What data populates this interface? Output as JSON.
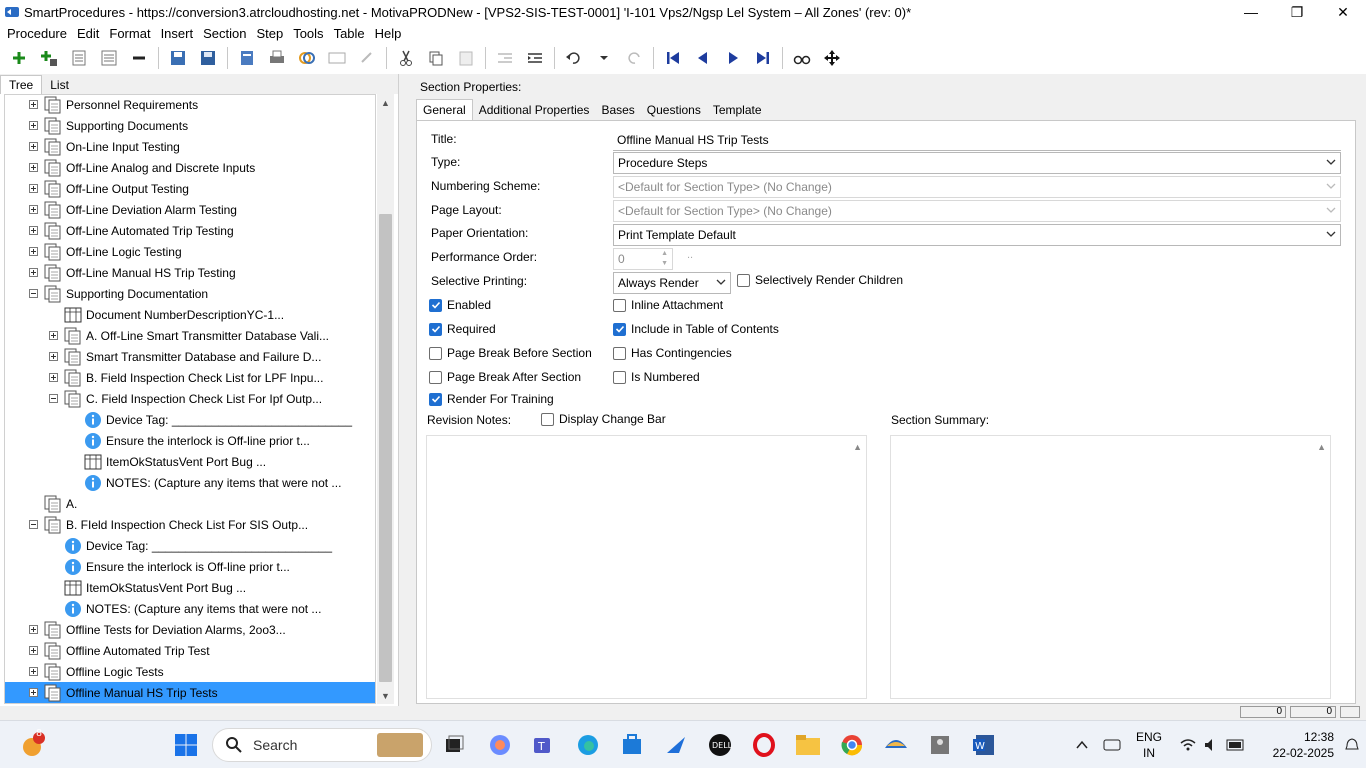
{
  "window": {
    "title": "SmartProcedures - https://conversion3.atrcloudhosting.net - MotivaPRODNew - [VPS2-SIS-TEST-0001] 'I-101 Vps2/Ngsp Lel System – All Zones' (rev: 0)*",
    "minimize": "—",
    "restore": "❐",
    "close": "✕"
  },
  "menu": [
    "Procedure",
    "Edit",
    "Format",
    "Insert",
    "Section",
    "Step",
    "Tools",
    "Table",
    "Help"
  ],
  "left_tabs": [
    "Tree",
    "List"
  ],
  "tree": [
    {
      "label": "Personnel Requirements",
      "expander": "plus",
      "icon": "section"
    },
    {
      "label": "Supporting Documents",
      "expander": "plus",
      "icon": "section"
    },
    {
      "label": "On-Line Input Testing",
      "expander": "plus",
      "icon": "section"
    },
    {
      "label": "Off-Line Analog and Discrete Inputs",
      "expander": "plus",
      "icon": "section"
    },
    {
      "label": "Off-Line Output Testing",
      "expander": "plus",
      "icon": "section"
    },
    {
      "label": "Off-Line Deviation Alarm Testing",
      "expander": "plus",
      "icon": "section"
    },
    {
      "label": "Off-Line Automated Trip Testing",
      "expander": "plus",
      "icon": "section"
    },
    {
      "label": "Off-Line Logic Testing",
      "expander": "plus",
      "icon": "section"
    },
    {
      "label": "Off-Line Manual HS Trip Testing",
      "expander": "plus",
      "icon": "section"
    },
    {
      "label": "Supporting Documentation",
      "expander": "minus",
      "icon": "section"
    },
    {
      "label": "Document NumberDescriptionYC-1...",
      "expander": "none",
      "icon": "table"
    },
    {
      "label": "A. Off-Line Smart Transmitter Database Vali...",
      "expander": "plus",
      "icon": "section"
    },
    {
      "label": "Smart Transmitter Database and Failure D...",
      "expander": "plus",
      "icon": "section"
    },
    {
      "label": "B. Field Inspection Check List for LPF Inpu...",
      "expander": "plus",
      "icon": "section"
    },
    {
      "label": "C. Field Inspection Check List For Ipf Outp...",
      "expander": "minus",
      "icon": "section"
    },
    {
      "label": "Device Tag: ___________________________",
      "expander": "none",
      "icon": "info"
    },
    {
      "label": "Ensure the interlock is Off-line prior t...",
      "expander": "none",
      "icon": "info"
    },
    {
      "label": "ItemOkStatusVent Port Bug ...",
      "expander": "none",
      "icon": "table"
    },
    {
      "label": "NOTES: (Capture any items that were not ...",
      "expander": "none",
      "icon": "info"
    },
    {
      "label": "A.",
      "expander": "none",
      "icon": "section"
    },
    {
      "label": "B. FIeld Inspection Check List For SIS Outp...",
      "expander": "minus",
      "icon": "section"
    },
    {
      "label": "Device Tag: ___________________________",
      "expander": "none",
      "icon": "info"
    },
    {
      "label": "Ensure the interlock is Off-line prior t...",
      "expander": "none",
      "icon": "info"
    },
    {
      "label": "ItemOkStatusVent Port Bug ...",
      "expander": "none",
      "icon": "table"
    },
    {
      "label": "NOTES: (Capture any items that were not ...",
      "expander": "none",
      "icon": "info"
    },
    {
      "label": "Offline Tests for Deviation Alarms, 2oo3...",
      "expander": "plus",
      "icon": "section"
    },
    {
      "label": "Offline Automated Trip Test",
      "expander": "plus",
      "icon": "section"
    },
    {
      "label": "Offline Logic Tests",
      "expander": "plus",
      "icon": "section"
    },
    {
      "label": "Offline Manual HS Trip Tests",
      "expander": "plus",
      "icon": "section",
      "selected": true
    }
  ],
  "section_properties_label": "Section Properties:",
  "right_tabs": [
    "General",
    "Additional Properties",
    "Bases",
    "Questions",
    "Template"
  ],
  "general": {
    "title_label": "Title:",
    "title_value": "Offline Manual HS Trip Tests",
    "type_label": "Type:",
    "type_value": "Procedure Steps",
    "numbering_label": "Numbering Scheme:",
    "numbering_value": "<Default for Section Type> (No Change)",
    "page_layout_label": "Page Layout:",
    "page_layout_value": "<Default for Section Type> (No Change)",
    "orientation_label": "Paper Orientation:",
    "orientation_value": "Print Template Default",
    "perf_label": "Performance Order:",
    "perf_value": "0",
    "perf_btn": "..",
    "selective_label": "Selective Printing:",
    "selective_value": "Always Render",
    "selectively_render_children": "Selectively Render Children",
    "enabled": "Enabled",
    "required": "Required",
    "page_break_before": "Page Break Before Section",
    "page_break_after": "Page Break After Section",
    "render_training": "Render For Training",
    "inline_attachment": "Inline Attachment",
    "include_toc": "Include in Table of Contents",
    "has_contingencies": "Has Contingencies",
    "is_numbered": "Is Numbered",
    "revision_notes": "Revision Notes:",
    "display_change_bar": "Display Change Bar",
    "section_summary": "Section Summary:"
  },
  "checkbox_states": {
    "selectively_render_children": false,
    "enabled": true,
    "required": true,
    "page_break_before": false,
    "page_break_after": false,
    "render_training": true,
    "inline_attachment": false,
    "include_toc": true,
    "has_contingencies": false,
    "is_numbered": false,
    "display_change_bar": false
  },
  "status_values": [
    "0",
    "0"
  ],
  "taskbar": {
    "search_placeholder": "Search",
    "notification_badge": "8",
    "language": "ENG",
    "region": "IN",
    "time": "12:38",
    "date": "22-02-2025"
  },
  "colors": {
    "selection": "#3399ff",
    "checkbox_checked": "#1f6fd1",
    "nav_arrows": "#1e3c9e"
  }
}
